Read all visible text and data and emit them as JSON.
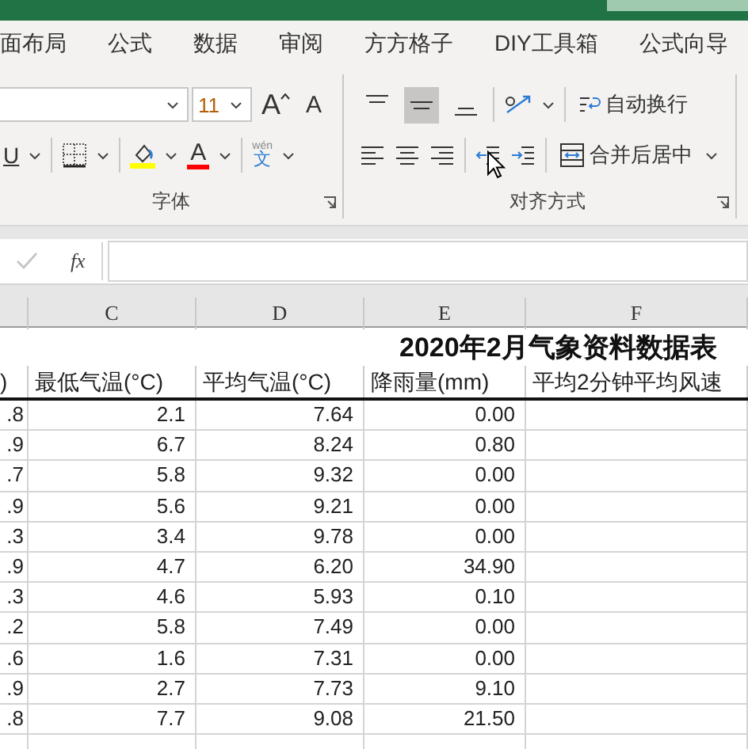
{
  "tabs": [
    {
      "label": "面布局",
      "selected": false
    },
    {
      "label": "公式",
      "selected": false
    },
    {
      "label": "数据",
      "selected": false
    },
    {
      "label": "审阅",
      "selected": false
    },
    {
      "label": "方方格子",
      "selected": false
    },
    {
      "label": "DIY工具箱",
      "selected": false
    },
    {
      "label": "公式向导",
      "selected": false
    }
  ],
  "font_group": {
    "label": "字体",
    "font_size": "11",
    "grow_font": "A",
    "shrink_font": "A",
    "underline": "U",
    "font_color": "A",
    "phonetic": "文",
    "phonetic_reading": "wén"
  },
  "align_group": {
    "label": "对齐方式",
    "wrap_text": "自动换行",
    "merge_center": "合并后居中",
    "vertical": [
      {
        "kind": "top",
        "selected": false
      },
      {
        "kind": "middle",
        "selected": true
      },
      {
        "kind": "bottom",
        "selected": false
      }
    ]
  },
  "formula_bar": {
    "enter_disabled": true,
    "fx": "fx"
  },
  "sheet": {
    "columns": [
      "C",
      "D",
      "E",
      "F"
    ],
    "title": "2020年2月气象资料数据表",
    "headers": [
      ")",
      "最低气温(°C)",
      "平均气温(°C)",
      "降雨量(mm)",
      "平均2分钟平均风速"
    ],
    "rows": [
      [
        ".8",
        "2.1",
        "7.64",
        "0.00"
      ],
      [
        ".9",
        "6.7",
        "8.24",
        "0.80"
      ],
      [
        ".7",
        "5.8",
        "9.32",
        "0.00"
      ],
      [
        ".9",
        "5.6",
        "9.21",
        "0.00"
      ],
      [
        ".3",
        "3.4",
        "9.78",
        "0.00"
      ],
      [
        ".9",
        "4.7",
        "6.20",
        "34.90"
      ],
      [
        ".3",
        "4.6",
        "5.93",
        "0.10"
      ],
      [
        ".2",
        "5.8",
        "7.49",
        "0.00"
      ],
      [
        ".6",
        "1.6",
        "7.31",
        "0.00"
      ],
      [
        ".9",
        "2.7",
        "7.73",
        "9.10"
      ],
      [
        ".8",
        "7.7",
        "9.08",
        "21.50"
      ]
    ]
  }
}
